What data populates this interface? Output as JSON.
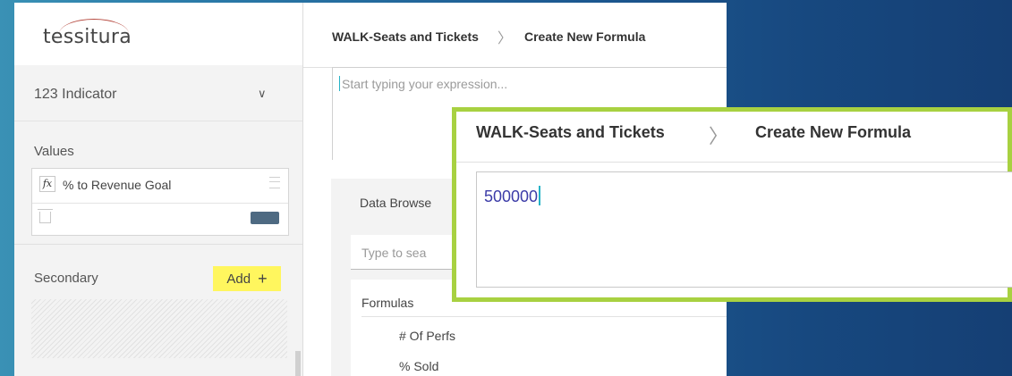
{
  "app": {
    "logo_text": "tessitura"
  },
  "indicator": {
    "label": "123  Indicator"
  },
  "values": {
    "label": "Values",
    "items": [
      {
        "name": "% to Revenue Goal",
        "color": "#4e6a82"
      }
    ]
  },
  "secondary": {
    "label": "Secondary",
    "add_label": "Add",
    "add_highlight": "#fff65e"
  },
  "breadcrumb": {
    "items": [
      "WALK-Seats and Tickets",
      "Create New Formula"
    ]
  },
  "expression": {
    "placeholder": "Start typing your expression...",
    "value": "500000"
  },
  "data_browser": {
    "label": "Data Browse",
    "search_placeholder": "Type to sea",
    "group_label": "Formulas",
    "items": [
      "# Of Perfs",
      "% Sold"
    ]
  },
  "zoom": {
    "border_color": "#a8d141"
  }
}
